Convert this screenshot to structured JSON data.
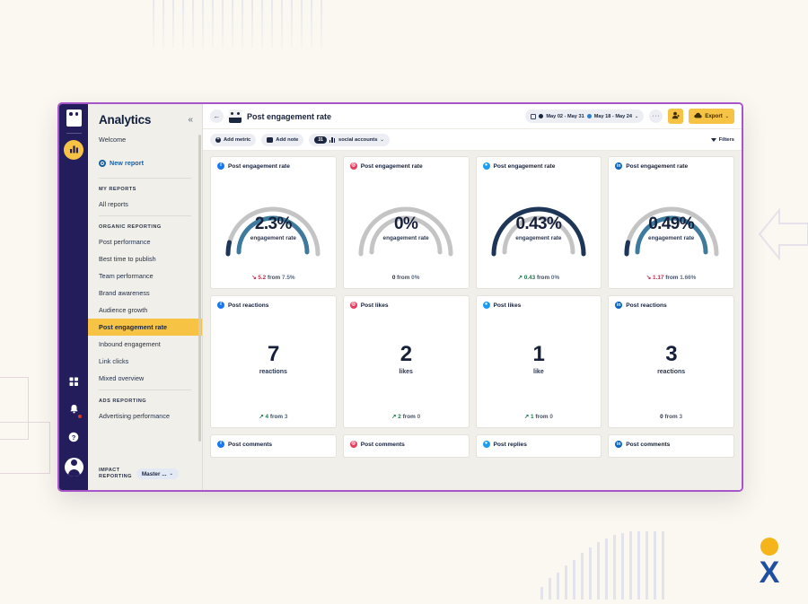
{
  "rail": {
    "logo_icon": "owl-logo-icon",
    "items": [
      {
        "name": "analytics",
        "icon": "bar-chart-icon",
        "active": true
      }
    ],
    "bottom": [
      {
        "name": "apps",
        "icon": "grid-apps-icon"
      },
      {
        "name": "notifications",
        "icon": "bell-icon",
        "badge": true
      },
      {
        "name": "help",
        "icon": "question-mark-icon"
      },
      {
        "name": "profile",
        "icon": "avatar-icon"
      }
    ]
  },
  "sidebar": {
    "title": "Analytics",
    "collapse_label": "«",
    "welcome": "Welcome",
    "new_report": "New report",
    "sections": [
      {
        "heading": "MY REPORTS",
        "items": [
          {
            "label": "All reports",
            "active": false
          }
        ]
      },
      {
        "heading": "ORGANIC REPORTING",
        "items": [
          {
            "label": "Post performance",
            "active": false
          },
          {
            "label": "Best time to publish",
            "active": false
          },
          {
            "label": "Team performance",
            "active": false
          },
          {
            "label": "Brand awareness",
            "active": false
          },
          {
            "label": "Audience growth",
            "active": false
          },
          {
            "label": "Post engagement rate",
            "active": true
          },
          {
            "label": "Inbound engagement",
            "active": false
          },
          {
            "label": "Link clicks",
            "active": false
          },
          {
            "label": "Mixed overview",
            "active": false
          }
        ]
      },
      {
        "heading": "ADS REPORTING",
        "items": [
          {
            "label": "Advertising performance",
            "active": false
          }
        ]
      }
    ],
    "impact_heading_line1": "IMPACT",
    "impact_heading_line2": "REPORTING",
    "impact_dropdown": "Master ...",
    "impact_chevron": "⌄"
  },
  "topbar": {
    "back_icon": "back-arrow-icon",
    "doc_icon": "report-doc-icon",
    "page_title": "Post engagement rate",
    "date_range_primary": "May 02 - May 31",
    "date_range_compare": "May 18 - May 24",
    "date_chevron": "⌄",
    "more_label": "···",
    "share_icon": "share-user-icon",
    "export_label": "Export",
    "export_icon": "export-cloud-icon",
    "export_chevron": "⌄"
  },
  "chipbar": {
    "add_metric": "Add metric",
    "add_note": "Add note",
    "accounts_count": "31",
    "accounts_label": "social accounts",
    "accounts_chevron": "⌄",
    "filters_label": "Filters"
  },
  "colors": {
    "accent_yellow": "#f6c344",
    "window_border": "#a855c9",
    "navy": "#241d5c",
    "gauge_dark": "#1d3557",
    "gauge_teal": "#3d7a9e",
    "gauge_gray": "#bfbfbf",
    "up_green": "#1d7a4c",
    "down_red": "#c0294a",
    "facebook": "#1877f2",
    "instagram": "#e4405f",
    "twitter": "#1d9bf0",
    "linkedin": "#0a66c2"
  },
  "chart_data": {
    "type": "bar",
    "title": "Post engagement rate",
    "xlabel": "",
    "ylabel": "",
    "categories": [
      "Facebook post engagement rate",
      "Instagram post engagement rate",
      "Twitter post engagement rate",
      "LinkedIn post engagement rate",
      "Facebook post reactions",
      "Instagram post likes",
      "Twitter post likes",
      "LinkedIn post reactions"
    ],
    "values": [
      2.3,
      0,
      0.43,
      0.49,
      7,
      2,
      1,
      3
    ],
    "previous_values": [
      7.5,
      0,
      0,
      1.66,
      3,
      0,
      0,
      3
    ],
    "deltas": [
      -5.2,
      0,
      0.43,
      -1.17,
      4,
      2,
      1,
      0
    ],
    "units": [
      "%",
      "%",
      "%",
      "%",
      "reactions",
      "likes",
      "like",
      "reactions"
    ],
    "gauge_max": 100,
    "grid": false,
    "legend": "none"
  },
  "cards": {
    "row_gauges": [
      {
        "network": "facebook",
        "network_glyph": "f",
        "network_icon": "facebook-icon",
        "title": "Post engagement rate",
        "value": "2.3%",
        "value_num": 2.3,
        "unit_label": "engagement rate",
        "trend": "down",
        "trend_arrow": "↘",
        "delta": "5.2",
        "from_word": "from",
        "from_value": "7.5%",
        "arc_outer_pct": 14,
        "arc_inner_pct": 92,
        "arc_state": "data"
      },
      {
        "network": "instagram",
        "network_glyph": "◎",
        "network_icon": "instagram-icon",
        "title": "Post engagement rate",
        "value": "0%",
        "value_num": 0,
        "unit_label": "engagement rate",
        "trend": "flat",
        "trend_arrow": "",
        "delta": "0",
        "from_word": "from",
        "from_value": "0%",
        "arc_outer_pct": 0,
        "arc_inner_pct": 0,
        "arc_state": "empty"
      },
      {
        "network": "twitter",
        "network_glyph": "●",
        "network_icon": "twitter-icon",
        "title": "Post engagement rate",
        "value": "0.43%",
        "value_num": 0.43,
        "unit_label": "engagement rate",
        "trend": "up",
        "trend_arrow": "↗",
        "delta": "0.43",
        "from_word": "from",
        "from_value": "0%",
        "arc_outer_pct": 100,
        "arc_inner_pct": 0,
        "arc_state": "dark-only"
      },
      {
        "network": "linkedin",
        "network_glyph": "in",
        "network_icon": "linkedin-icon",
        "title": "Post engagement rate",
        "value": "0.49%",
        "value_num": 0.49,
        "unit_label": "engagement rate",
        "trend": "down",
        "trend_arrow": "↘",
        "delta": "1.17",
        "from_word": "from",
        "from_value": "1.66%",
        "arc_outer_pct": 14,
        "arc_inner_pct": 88,
        "arc_state": "data"
      }
    ],
    "row_numbers": [
      {
        "network": "facebook",
        "network_glyph": "f",
        "network_icon": "facebook-icon",
        "title": "Post reactions",
        "value": "7",
        "unit_label": "reactions",
        "trend": "up",
        "trend_arrow": "↗",
        "delta": "4",
        "from_word": "from",
        "from_value": "3"
      },
      {
        "network": "instagram",
        "network_glyph": "◎",
        "network_icon": "instagram-icon",
        "title": "Post likes",
        "value": "2",
        "unit_label": "likes",
        "trend": "up",
        "trend_arrow": "↗",
        "delta": "2",
        "from_word": "from",
        "from_value": "0"
      },
      {
        "network": "twitter",
        "network_glyph": "●",
        "network_icon": "twitter-icon",
        "title": "Post likes",
        "value": "1",
        "unit_label": "like",
        "trend": "up",
        "trend_arrow": "↗",
        "delta": "1",
        "from_word": "from",
        "from_value": "0"
      },
      {
        "network": "linkedin",
        "network_glyph": "in",
        "network_icon": "linkedin-icon",
        "title": "Post reactions",
        "value": "3",
        "unit_label": "reactions",
        "trend": "flat",
        "trend_arrow": "",
        "delta": "0",
        "from_word": "from",
        "from_value": "3"
      }
    ],
    "row_stubs": [
      {
        "network": "facebook",
        "network_glyph": "f",
        "network_icon": "facebook-icon",
        "title": "Post comments"
      },
      {
        "network": "instagram",
        "network_glyph": "◎",
        "network_icon": "instagram-icon",
        "title": "Post comments"
      },
      {
        "network": "twitter",
        "network_glyph": "●",
        "network_icon": "twitter-icon",
        "title": "Post replies"
      },
      {
        "network": "linkedin",
        "network_glyph": "in",
        "network_icon": "linkedin-icon",
        "title": "Post comments"
      }
    ]
  },
  "brand": {
    "logo_name": "x-dot-logo"
  }
}
